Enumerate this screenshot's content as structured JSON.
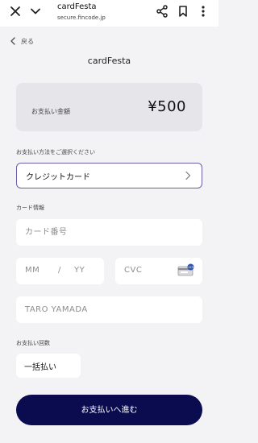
{
  "browser": {
    "title": "cardFesta",
    "url": "secure.fincode.jp"
  },
  "nav": {
    "back_label": "戻る"
  },
  "merchant": "cardFesta",
  "amount": {
    "label": "お支払い金額",
    "value": "¥500"
  },
  "payment_method": {
    "section_label": "お支払い方法をご選択ください",
    "selected": "クレジットカード"
  },
  "card_info": {
    "section_label": "カード情報",
    "card_number_placeholder": "カード番号",
    "expiry_month_placeholder": "MM",
    "expiry_separator": "/",
    "expiry_year_placeholder": "YY",
    "cvc_placeholder": "CVC",
    "holder_placeholder": "TARO YAMADA"
  },
  "installments": {
    "section_label": "お支払い回数",
    "selected": "一括払い"
  },
  "submit_label": "お支払いへ進む",
  "colors": {
    "accent": "#0b0b50",
    "select_border": "#6b5ea8",
    "background": "#f3f3f5"
  }
}
